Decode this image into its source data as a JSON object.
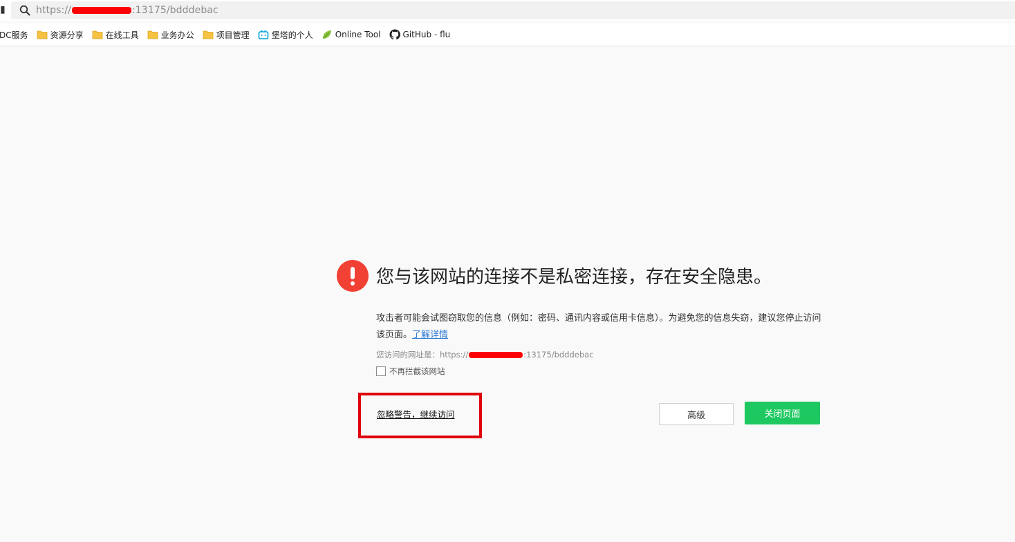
{
  "browser": {
    "url_prefix": "https://",
    "url_suffix": ":13175/bdddebac"
  },
  "bookmarks": [
    {
      "label": "DC服务",
      "icon": "none-icon"
    },
    {
      "label": "资源分享",
      "icon": "folder-icon"
    },
    {
      "label": "在线工具",
      "icon": "folder-icon"
    },
    {
      "label": "业务办公",
      "icon": "folder-icon"
    },
    {
      "label": "项目管理",
      "icon": "folder-icon"
    },
    {
      "label": "堡塔的个人",
      "icon": "bilibili-icon"
    },
    {
      "label": "Online Tool",
      "icon": "leaf-icon"
    },
    {
      "label": "GitHub - flu",
      "icon": "github-icon"
    }
  ],
  "warning": {
    "headline": "您与该网站的连接不是私密连接，存在安全隐患。",
    "description": "攻击者可能会试图窃取您的信息（例如：密码、通讯内容或信用卡信息）。为避免您的信息失窃，建议您停止访问该页面。",
    "learn_more": "了解详情",
    "visited_url_label": "您访问的网址是：",
    "visited_url_prefix": "https://",
    "visited_url_suffix": ":13175/bdddebac",
    "dont_block_label": "不再拦截该网站",
    "ignore_link": "忽略警告，继续访问",
    "advanced_button": "高级",
    "close_button": "关闭页面"
  },
  "colors": {
    "warning_red": "#f04134",
    "close_button_green": "#1ec860",
    "highlight_box": "#e0000b",
    "link_blue": "#2d7ad6"
  }
}
